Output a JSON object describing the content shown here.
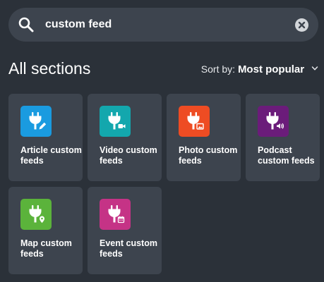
{
  "search": {
    "value": "custom feed",
    "icon": "search-icon",
    "clear_icon": "close-circle-icon"
  },
  "header": {
    "title": "All sections",
    "sort_label": "Sort by:",
    "sort_value": "Most popular",
    "sort_icon": "chevron-down-icon"
  },
  "cards": [
    {
      "label": "Article custom feeds",
      "color": "#1a9be0",
      "icon": "plug-pencil-icon"
    },
    {
      "label": "Video custom feeds",
      "color": "#13a7ad",
      "icon": "plug-video-icon"
    },
    {
      "label": "Photo custom feeds",
      "color": "#ee4c23",
      "icon": "plug-image-icon"
    },
    {
      "label": "Podcast custom feeds",
      "color": "#6b1c7a",
      "icon": "plug-speaker-icon"
    },
    {
      "label": "Map custom feeds",
      "color": "#5bb33b",
      "icon": "plug-pin-icon"
    },
    {
      "label": "Event custom feeds",
      "color": "#c53386",
      "icon": "plug-calendar-icon"
    }
  ]
}
